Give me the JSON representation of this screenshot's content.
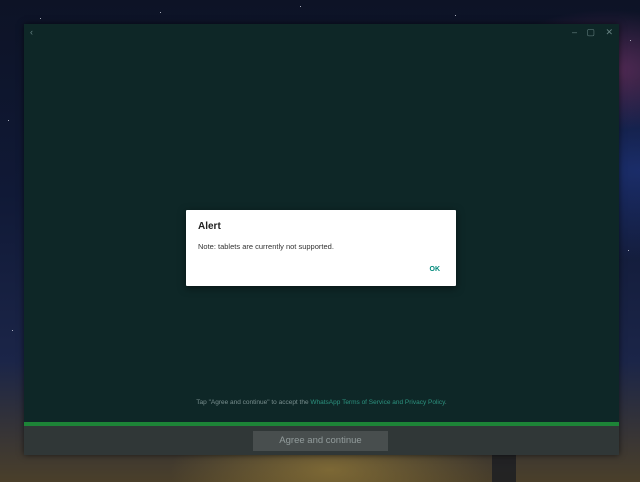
{
  "window": {
    "back_icon": "‹",
    "minimize_icon": "–",
    "maximize_icon": "▢",
    "close_icon": "✕"
  },
  "terms": {
    "prefix": "Tap \"Agree and continue\" to accept the ",
    "link": "WhatsApp Terms of Service and Privacy Policy",
    "suffix": "."
  },
  "agree_button": "Agree and continue",
  "dialog": {
    "title": "Alert",
    "message": "Note: tablets are currently not supported.",
    "ok": "OK"
  },
  "colors": {
    "accent": "#00897b",
    "window_bg": "#0f2a2a",
    "green_bar": "#1f8c3a"
  }
}
